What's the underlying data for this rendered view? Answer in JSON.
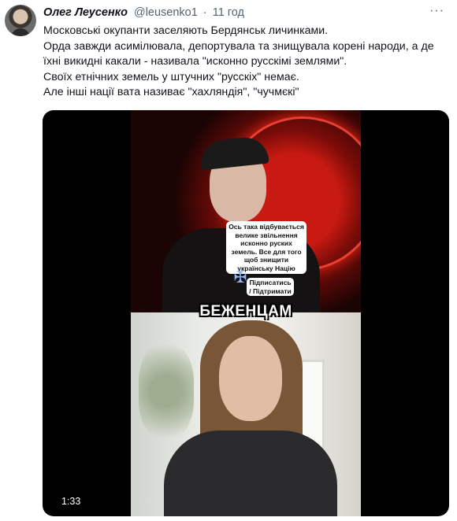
{
  "tweet": {
    "author_name": "Олег Леусенко",
    "author_handle": "@leusenko1",
    "separator": "·",
    "timestamp": "11 год",
    "more_icon": "more-horizontal-icon",
    "lines": [
      "Московські окупанти заселяють Бердянськ личинками.",
      "Орда завжди асимілювала, депортувала та знищувала корені народи, а де їхні викидні какали - називала \"исконно русскімі землями\".",
      "Своїх етнічних земель у штучних \"русскіх\" немає.",
      "Але інші нації вата називає \"хахляндія\", \"чучмєкі\""
    ]
  },
  "video": {
    "overlay_caption": "Ось така відбувається велике звільнення исконно руских земель. Все для того щоб знищити українську Націю",
    "overlay_subscribe": "Підписатись / Підтримати",
    "banner_text": "БЕЖЕНЦАМ",
    "duration": "1:33",
    "cross_icon": "orthodox-cross-icon"
  }
}
